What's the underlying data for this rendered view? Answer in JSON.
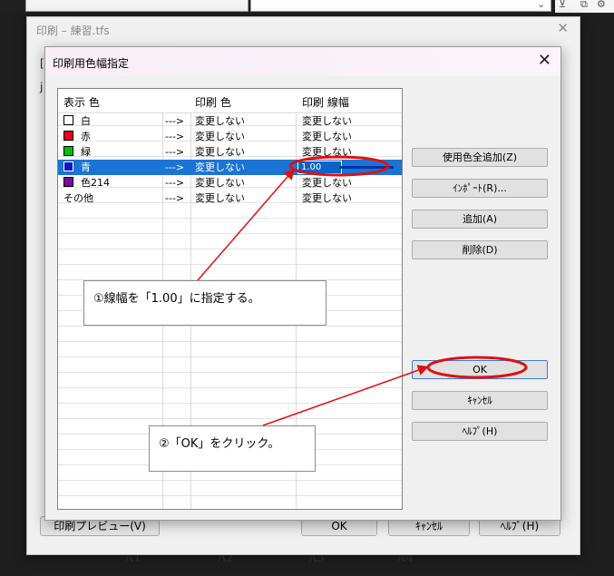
{
  "outer_window": {
    "title": "印刷 – 練習.tfs",
    "close": "✕",
    "fragment_1": "[",
    "fragment_2": "ј",
    "buttons": {
      "preview": "印刷プレビュー(V)",
      "ok": "OK",
      "cancel": "ｷｬﾝｾﾙ",
      "help": "ﾍﾙﾌﾟ(H)"
    }
  },
  "background": {
    "columns": [
      "A1",
      "A2",
      "A3",
      "A4"
    ]
  },
  "dialog": {
    "title": "印刷用色幅指定",
    "close": "✕",
    "table": {
      "headers": [
        "表示 色",
        "印刷 色",
        "印刷 線幅"
      ],
      "rows": [
        {
          "name": "白",
          "swatch": "#ffffff",
          "arrow": "--->",
          "print_color": "変更しない",
          "line_width": "変更しない"
        },
        {
          "name": "赤",
          "swatch": "#e0001a",
          "arrow": "--->",
          "print_color": "変更しない",
          "line_width": "変更しない"
        },
        {
          "name": "緑",
          "swatch": "#00c000",
          "arrow": "--->",
          "print_color": "変更しない",
          "line_width": "変更しない"
        },
        {
          "name": "青",
          "swatch": "#1414d0",
          "arrow": "--->",
          "print_color": "変更しない",
          "line_width": "1.00",
          "selected": true
        },
        {
          "name": "色214",
          "swatch": "#7a0a9a",
          "arrow": "--->",
          "print_color": "変更しない",
          "line_width": "変更しない"
        },
        {
          "name": "その他",
          "swatch": "",
          "arrow": "--->",
          "print_color": "変更しない",
          "line_width": "変更しない"
        }
      ]
    },
    "buttons": {
      "add_all": "使用色全追加(Z)",
      "import": "ｲﾝﾎﾟｰﾄ(R)...",
      "add": "追加(A)",
      "delete": "削除(D)",
      "ok": "OK",
      "cancel": "ｷｬﾝｾﾙ",
      "help": "ﾍﾙﾌﾟ(H)"
    }
  },
  "annotations": {
    "step1": "①線幅を「1.00」に指定する。",
    "step2": "②「OK」をクリック。"
  },
  "colors": {
    "selection": "#1a74d4",
    "annotation_red": "#e01010"
  }
}
